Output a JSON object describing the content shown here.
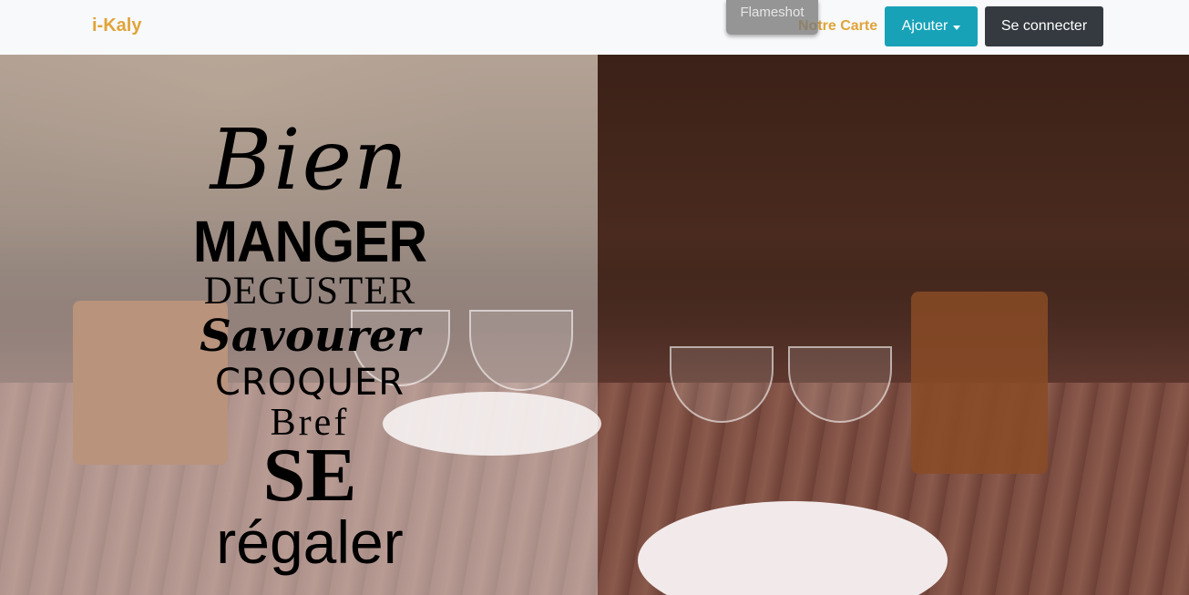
{
  "nav": {
    "brand": "i-Kaly",
    "link_notre_carte": "Notre Carte",
    "ajouter_label": "Ajouter",
    "connect_label": "Se connecter"
  },
  "overlay": {
    "flameshot": "Flameshot"
  },
  "hero": {
    "slogan": [
      "Bien",
      "MANGER",
      "DEGUSTER",
      "Savourer",
      "CROQUER",
      "Bref",
      "SE",
      "régaler"
    ]
  },
  "colors": {
    "brand": "#e0a43a",
    "ajouter_bg": "#17a2b8",
    "connect_bg": "#343a40",
    "navbar_bg": "#f8f9fb"
  }
}
